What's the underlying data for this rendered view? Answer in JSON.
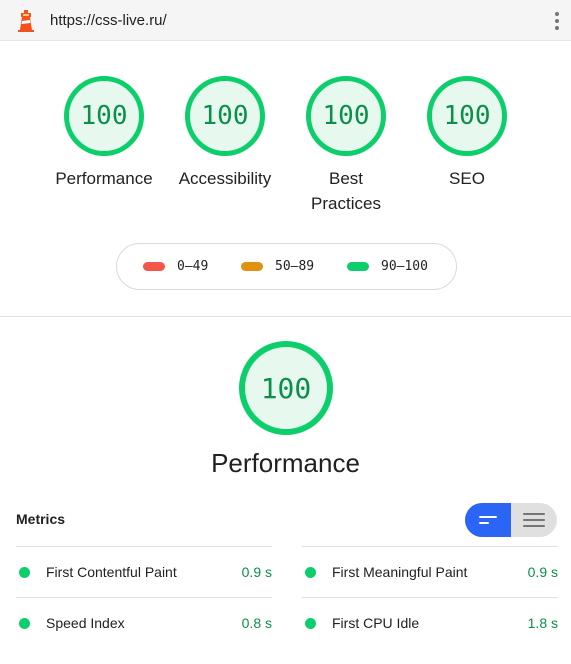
{
  "header": {
    "url": "https://css-live.ru/",
    "logo_icon": "lighthouse-icon",
    "menu_icon": "more-vert-icon"
  },
  "gauges": [
    {
      "score": "100",
      "label": "Performance"
    },
    {
      "score": "100",
      "label": "Accessibility"
    },
    {
      "score": "100",
      "label": "Best Practices"
    },
    {
      "score": "100",
      "label": "SEO"
    }
  ],
  "legend": [
    {
      "range": "0–49",
      "color": "#f4564a"
    },
    {
      "range": "50–89",
      "color": "#e0920f"
    },
    {
      "range": "90–100",
      "color": "#0cce6b"
    }
  ],
  "performance": {
    "score": "100",
    "title": "Performance"
  },
  "metrics": {
    "title": "Metrics",
    "view_toggle": {
      "active": "compact-view",
      "inactive": "expanded-view"
    },
    "items": [
      {
        "name": "First Contentful Paint",
        "value": "0.9 s"
      },
      {
        "name": "First Meaningful Paint",
        "value": "0.9 s"
      },
      {
        "name": "Speed Index",
        "value": "0.8 s"
      },
      {
        "name": "First CPU Idle",
        "value": "1.8 s"
      }
    ]
  },
  "colors": {
    "pass": "#0cce6b",
    "pass_text": "#0b8f4a",
    "accent": "#2a65f5"
  }
}
